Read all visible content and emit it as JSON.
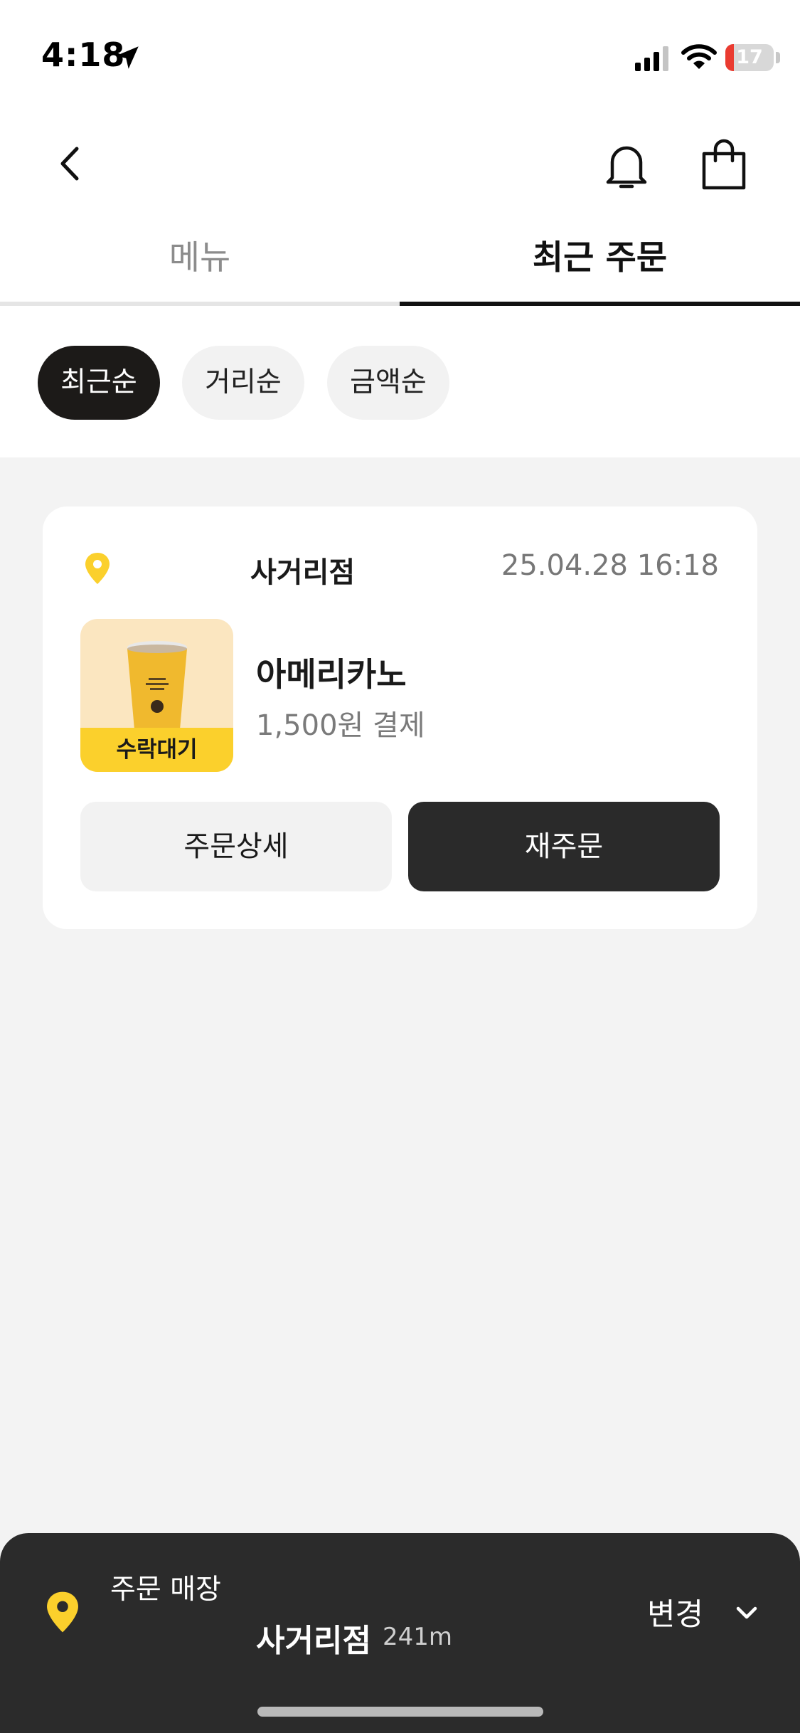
{
  "status_bar": {
    "time": "4:18",
    "battery_level": "17",
    "battery_fraction": 0.17
  },
  "nav": {
    "back_icon": "chevron-left-icon",
    "bell_icon": "bell-icon",
    "bag_icon": "shopping-bag-icon"
  },
  "tabs": [
    {
      "label": "메뉴",
      "active": false
    },
    {
      "label": "최근 주문",
      "active": true
    }
  ],
  "filters": [
    {
      "label": "최근순",
      "selected": true
    },
    {
      "label": "거리순",
      "selected": false
    },
    {
      "label": "금액순",
      "selected": false
    }
  ],
  "orders": [
    {
      "store": "사거리점",
      "date": "25.04.28 16:18",
      "status": "수락대기",
      "product": "아메리카노",
      "price": "1,500원 결제",
      "detail_label": "주문상세",
      "reorder_label": "재주문"
    }
  ],
  "bottom_bar": {
    "label": "주문 매장",
    "store": "사거리점",
    "distance": "241m",
    "change_label": "변경"
  },
  "colors": {
    "accent_yellow": "#fbd02c",
    "dark": "#2b2b2b",
    "background": "#f3f3f3",
    "battery_low": "#ea3b30"
  }
}
